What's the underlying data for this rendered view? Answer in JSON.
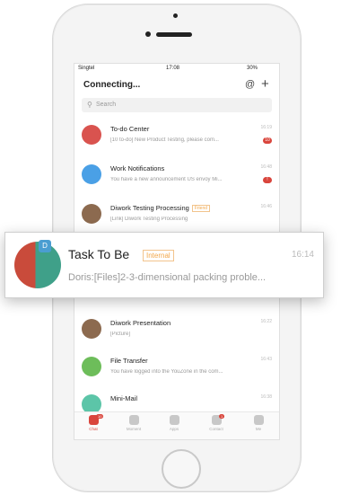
{
  "status": {
    "carrier": "Singtel",
    "time": "17:08",
    "battery": "30%"
  },
  "header": {
    "title": "Connecting...",
    "at_label": "@",
    "plus_label": "+"
  },
  "search": {
    "placeholder": "Search"
  },
  "rows": [
    {
      "title": "To-do Center",
      "sub": "[10 to-do] New Product Testing, please com...",
      "time": "16:19",
      "badge": "10",
      "color": "#d9534f"
    },
    {
      "title": "Work Notifications",
      "sub": "You have a new announcement US envoy Mi...",
      "time": "16:48",
      "badge": "!",
      "color": "#4aa0e6"
    },
    {
      "title": "Diwork Testing Processing",
      "tag": "Friend",
      "sub": "[Link] Diwork Testing Processing",
      "time": "16:46",
      "color": "#8c6a4f"
    },
    {
      "title": "Diwork Presentation",
      "sub": "[Picture]",
      "time": "16:22",
      "color": "#8c6a4f"
    },
    {
      "title": "File Transfer",
      "sub": "You have logged into the YouZone in the com...",
      "time": "16:43",
      "color": "#6dbd5a"
    },
    {
      "title": "Mini-Mail",
      "sub": "",
      "time": "16:38",
      "color": "#5cc5a8"
    }
  ],
  "tabs": [
    {
      "label": "Chat",
      "badge": "10"
    },
    {
      "label": "Moment"
    },
    {
      "label": "Apps"
    },
    {
      "label": "Contact",
      "badge": "1"
    },
    {
      "label": "Me"
    }
  ],
  "popup": {
    "title": "Task To  Be",
    "tag": "Internal",
    "time": "16:14",
    "sub": "Doris:[Files]2-3-dimensional packing proble...",
    "avatar_letter": "D"
  },
  "colors": {
    "accent": "#d9453c",
    "tag": "#f2a74a"
  }
}
